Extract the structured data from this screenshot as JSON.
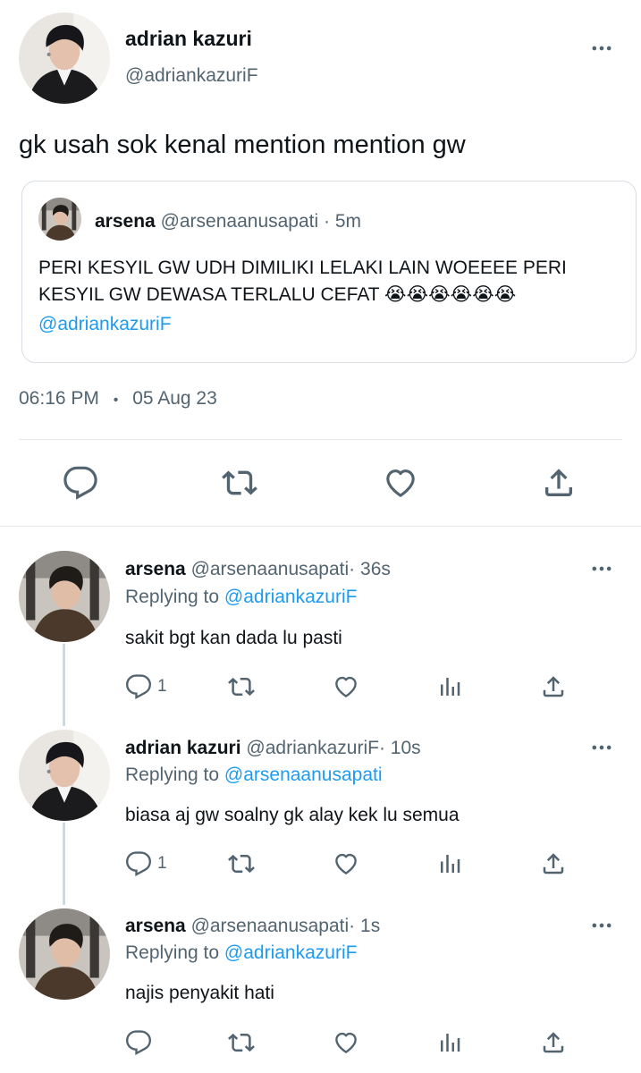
{
  "main_tweet": {
    "author_name": "adrian kazuri",
    "author_handle": "@adriankazuriF",
    "text": "gk usah sok kenal mention mention gw",
    "quote": {
      "author_name": "arsena",
      "author_handle": "@arsenaanusapati",
      "separator": "·",
      "time": "5m",
      "text": "PERI KESYIL GW UDH DIMILIKI LELAKI LAIN WOEEEE PERI KESYIL GW DEWASA TERLALU CEFAT 😭😭😭😭😭😭",
      "mention": "@adriankazuriF"
    },
    "time": "06:16 PM",
    "dot": "•",
    "date": "05 Aug 23"
  },
  "replies": [
    {
      "author_name": "arsena",
      "author_handle": "@arsenaanusapati",
      "separator": "·",
      "time": "36s",
      "replying_label": "Replying to",
      "replying_to": "@adriankazuriF",
      "text": "sakit bgt kan dada lu pasti",
      "reply_count": "1"
    },
    {
      "author_name": "adrian kazuri",
      "author_handle": "@adriankazuriF",
      "separator": "·",
      "time": "10s",
      "replying_label": "Replying to",
      "replying_to": "@arsenaanusapati",
      "text": "biasa aj gw soalny gk alay kek lu semua",
      "reply_count": "1"
    },
    {
      "author_name": "arsena",
      "author_handle": "@arsenaanusapati",
      "separator": "·",
      "time": "1s",
      "replying_label": "Replying to",
      "replying_to": "@adriankazuriF",
      "text": "najis penyakit hati",
      "reply_count": ""
    }
  ],
  "icons": {
    "reply": "comment-icon",
    "retweet": "retweet-icon",
    "like": "heart-icon",
    "share": "share-icon",
    "views": "analytics-icon",
    "more": "more-icon"
  },
  "colors": {
    "link": "#1d9bf0",
    "secondary_text": "#536471",
    "primary_text": "#0f1419"
  }
}
